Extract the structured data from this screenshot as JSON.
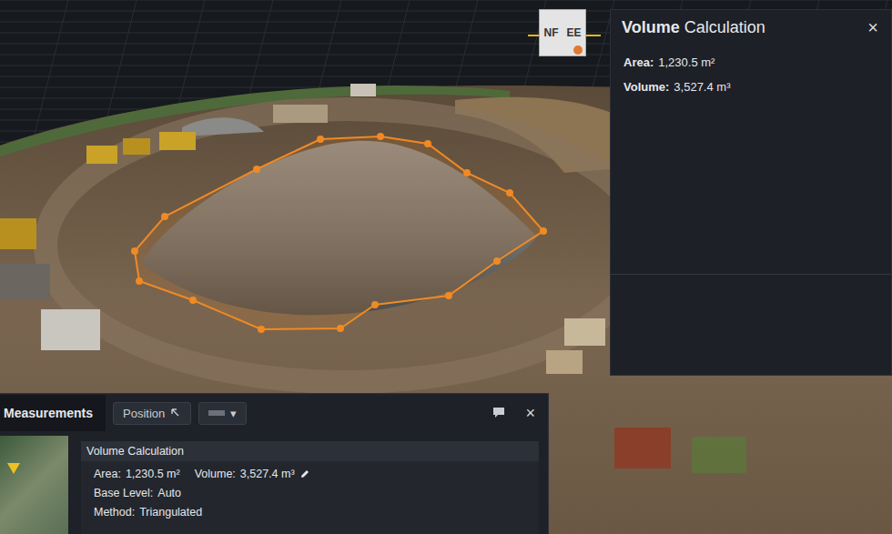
{
  "view_cube": {
    "faces": [
      "NF",
      "EE"
    ]
  },
  "volume_panel": {
    "title_strong": "Volume",
    "title_rest": "Calculation",
    "close": "×",
    "fields": [
      {
        "label": "Area:",
        "value": "1,230.5 m²"
      },
      {
        "label": "Volume:",
        "value": "3,527.4 m³"
      }
    ]
  },
  "measurements_panel": {
    "tabs": [
      {
        "label": "Measurements",
        "selected": true
      }
    ],
    "position_button": "Position",
    "dropdown": "▾",
    "close": "×",
    "card": {
      "title": "Volume Calculation",
      "rows": [
        [
          {
            "label": "Area:",
            "value": "1,230.5 m²",
            "editable": false
          },
          {
            "label": "Volume:",
            "value": "3,527.4 m³",
            "editable": true
          }
        ],
        [
          {
            "label": "Base Level:",
            "value": "Auto",
            "editable": false
          }
        ],
        [
          {
            "label": "Method:",
            "value": "Triangulated",
            "editable": false
          }
        ]
      ]
    }
  }
}
